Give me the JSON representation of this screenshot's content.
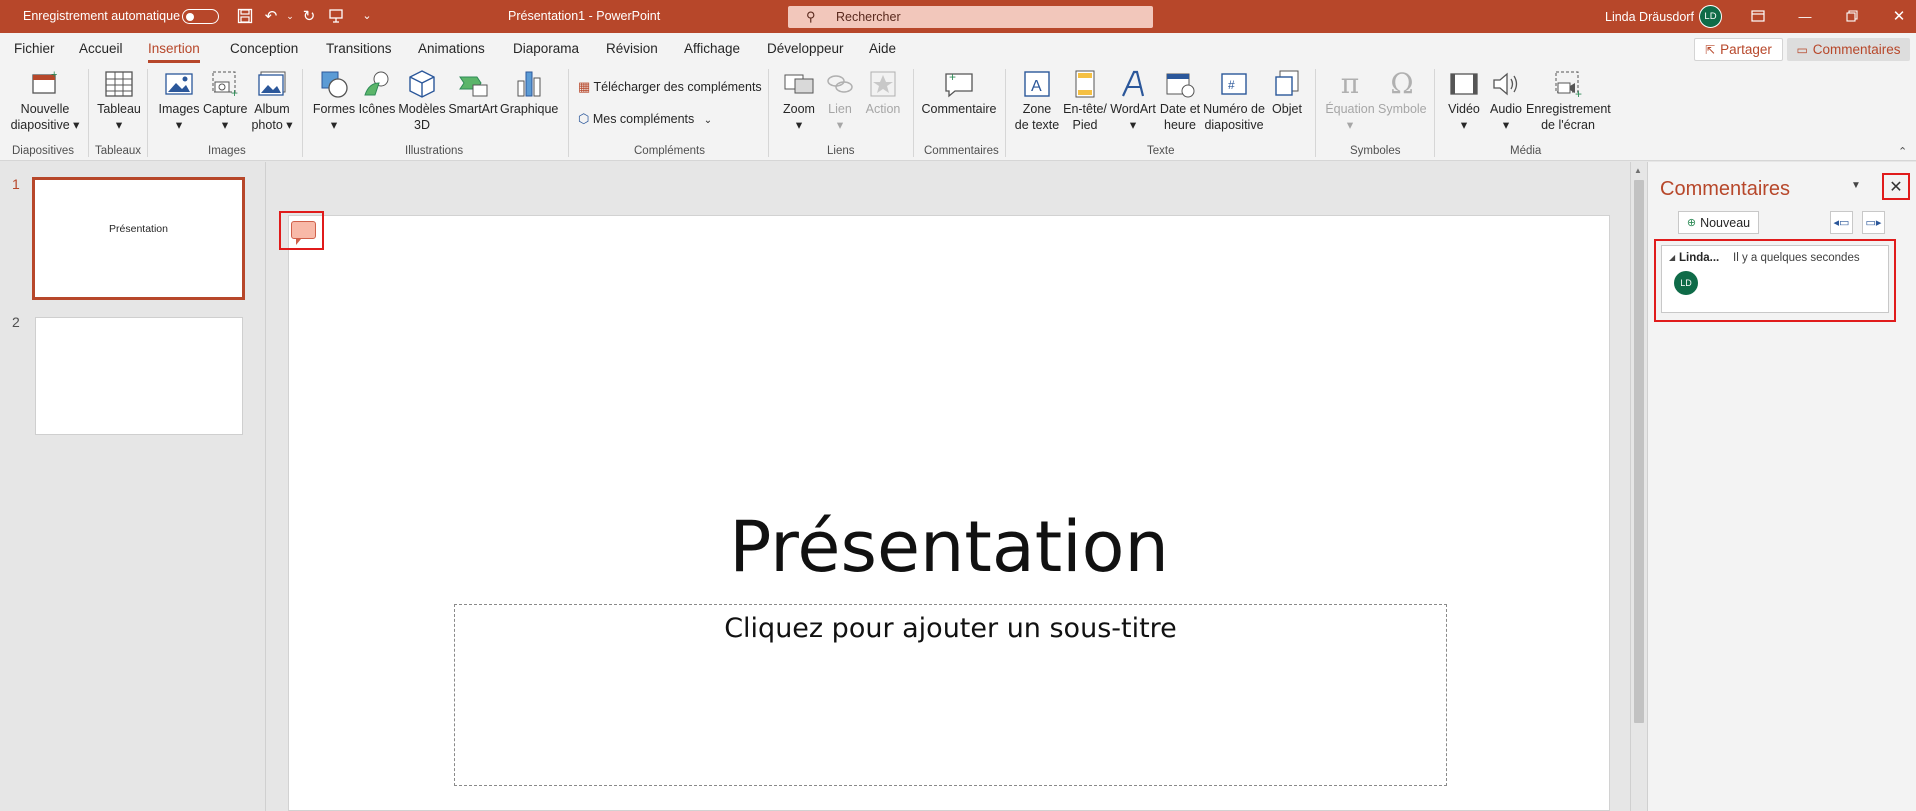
{
  "titlebar": {
    "autosave_label": "Enregistrement automatique",
    "doc_title": "Présentation1  -  PowerPoint",
    "search_placeholder": "Rechercher",
    "user_name": "Linda Dräusdorf",
    "user_initials": "LD",
    "save_icon": "save-icon",
    "undo_icon": "undo-icon",
    "redo_icon": "redo-icon",
    "present_icon": "present-icon",
    "customize_icon": "customize-qat-icon"
  },
  "tabs": [
    "Fichier",
    "Accueil",
    "Insertion",
    "Conception",
    "Transitions",
    "Animations",
    "Diaporama",
    "Révision",
    "Affichage",
    "Développeur",
    "Aide"
  ],
  "active_tab": "Insertion",
  "share_label": "Partager",
  "comments_label": "Commentaires",
  "ribbon": {
    "nouvelle_diapo": [
      "Nouvelle",
      "diapositive"
    ],
    "tableau": "Tableau",
    "images": "Images",
    "capture": "Capture",
    "album": [
      "Album",
      "photo"
    ],
    "formes": "Formes",
    "icones": "Icônes",
    "modeles3d": [
      "Modèles",
      "3D"
    ],
    "smartart": "SmartArt",
    "graphique": "Graphique",
    "telecharger": "Télécharger des compléments",
    "mes_complements": "Mes compléments",
    "zoom": "Zoom",
    "lien": "Lien",
    "action": "Action",
    "commentaire": "Commentaire",
    "zone_texte": [
      "Zone",
      "de texte"
    ],
    "entete": [
      "En-tête/",
      "Pied"
    ],
    "wordart": "WordArt",
    "date_heure": [
      "Date et",
      "heure"
    ],
    "numero": [
      "Numéro de",
      "diapositive"
    ],
    "objet": "Objet",
    "equation": "Équation",
    "symbole": "Symbole",
    "video": "Vidéo",
    "audio": "Audio",
    "enregistrement": [
      "Enregistrement",
      "de l'écran"
    ],
    "groups": {
      "diapositives": "Diapositives",
      "tableaux": "Tableaux",
      "images": "Images",
      "illustrations": "Illustrations",
      "complements": "Compléments",
      "liens": "Liens",
      "commentaires": "Commentaires",
      "texte": "Texte",
      "symboles": "Symboles",
      "media": "Média"
    }
  },
  "slides": [
    {
      "number": "1",
      "thumb_title": "Présentation"
    },
    {
      "number": "2",
      "thumb_title": ""
    }
  ],
  "slide": {
    "title": "Présentation",
    "subtitle_placeholder": "Cliquez pour ajouter un sous-titre"
  },
  "comments_pane": {
    "title": "Commentaires",
    "new_label": "Nouveau",
    "close_icon": "close-icon",
    "comment": {
      "author": "Linda...",
      "time": "Il y a quelques secondes",
      "initials": "LD"
    }
  },
  "colors": {
    "accent": "#b7472a",
    "highlight": "#e01b1b",
    "avatar": "#0f6b48"
  }
}
